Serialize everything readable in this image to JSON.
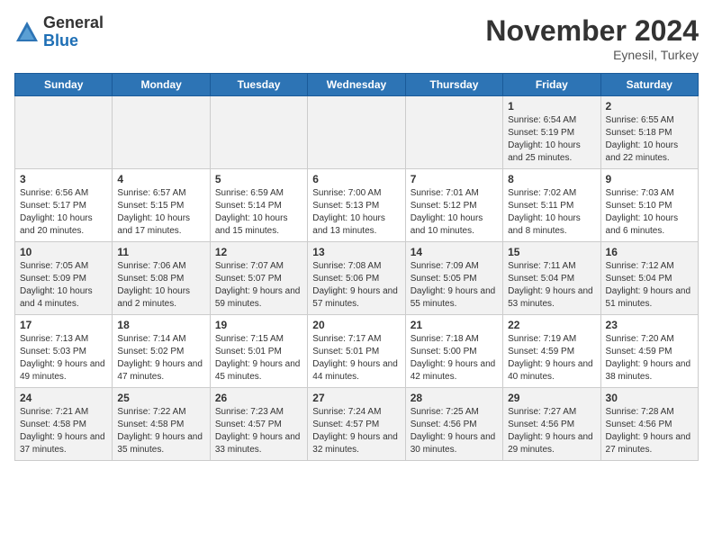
{
  "logo": {
    "general": "General",
    "blue": "Blue"
  },
  "header": {
    "month": "November 2024",
    "location": "Eynesil, Turkey"
  },
  "days_of_week": [
    "Sunday",
    "Monday",
    "Tuesday",
    "Wednesday",
    "Thursday",
    "Friday",
    "Saturday"
  ],
  "weeks": [
    [
      {
        "day": "",
        "info": ""
      },
      {
        "day": "",
        "info": ""
      },
      {
        "day": "",
        "info": ""
      },
      {
        "day": "",
        "info": ""
      },
      {
        "day": "",
        "info": ""
      },
      {
        "day": "1",
        "info": "Sunrise: 6:54 AM\nSunset: 5:19 PM\nDaylight: 10 hours and 25 minutes."
      },
      {
        "day": "2",
        "info": "Sunrise: 6:55 AM\nSunset: 5:18 PM\nDaylight: 10 hours and 22 minutes."
      }
    ],
    [
      {
        "day": "3",
        "info": "Sunrise: 6:56 AM\nSunset: 5:17 PM\nDaylight: 10 hours and 20 minutes."
      },
      {
        "day": "4",
        "info": "Sunrise: 6:57 AM\nSunset: 5:15 PM\nDaylight: 10 hours and 17 minutes."
      },
      {
        "day": "5",
        "info": "Sunrise: 6:59 AM\nSunset: 5:14 PM\nDaylight: 10 hours and 15 minutes."
      },
      {
        "day": "6",
        "info": "Sunrise: 7:00 AM\nSunset: 5:13 PM\nDaylight: 10 hours and 13 minutes."
      },
      {
        "day": "7",
        "info": "Sunrise: 7:01 AM\nSunset: 5:12 PM\nDaylight: 10 hours and 10 minutes."
      },
      {
        "day": "8",
        "info": "Sunrise: 7:02 AM\nSunset: 5:11 PM\nDaylight: 10 hours and 8 minutes."
      },
      {
        "day": "9",
        "info": "Sunrise: 7:03 AM\nSunset: 5:10 PM\nDaylight: 10 hours and 6 minutes."
      }
    ],
    [
      {
        "day": "10",
        "info": "Sunrise: 7:05 AM\nSunset: 5:09 PM\nDaylight: 10 hours and 4 minutes."
      },
      {
        "day": "11",
        "info": "Sunrise: 7:06 AM\nSunset: 5:08 PM\nDaylight: 10 hours and 2 minutes."
      },
      {
        "day": "12",
        "info": "Sunrise: 7:07 AM\nSunset: 5:07 PM\nDaylight: 9 hours and 59 minutes."
      },
      {
        "day": "13",
        "info": "Sunrise: 7:08 AM\nSunset: 5:06 PM\nDaylight: 9 hours and 57 minutes."
      },
      {
        "day": "14",
        "info": "Sunrise: 7:09 AM\nSunset: 5:05 PM\nDaylight: 9 hours and 55 minutes."
      },
      {
        "day": "15",
        "info": "Sunrise: 7:11 AM\nSunset: 5:04 PM\nDaylight: 9 hours and 53 minutes."
      },
      {
        "day": "16",
        "info": "Sunrise: 7:12 AM\nSunset: 5:04 PM\nDaylight: 9 hours and 51 minutes."
      }
    ],
    [
      {
        "day": "17",
        "info": "Sunrise: 7:13 AM\nSunset: 5:03 PM\nDaylight: 9 hours and 49 minutes."
      },
      {
        "day": "18",
        "info": "Sunrise: 7:14 AM\nSunset: 5:02 PM\nDaylight: 9 hours and 47 minutes."
      },
      {
        "day": "19",
        "info": "Sunrise: 7:15 AM\nSunset: 5:01 PM\nDaylight: 9 hours and 45 minutes."
      },
      {
        "day": "20",
        "info": "Sunrise: 7:17 AM\nSunset: 5:01 PM\nDaylight: 9 hours and 44 minutes."
      },
      {
        "day": "21",
        "info": "Sunrise: 7:18 AM\nSunset: 5:00 PM\nDaylight: 9 hours and 42 minutes."
      },
      {
        "day": "22",
        "info": "Sunrise: 7:19 AM\nSunset: 4:59 PM\nDaylight: 9 hours and 40 minutes."
      },
      {
        "day": "23",
        "info": "Sunrise: 7:20 AM\nSunset: 4:59 PM\nDaylight: 9 hours and 38 minutes."
      }
    ],
    [
      {
        "day": "24",
        "info": "Sunrise: 7:21 AM\nSunset: 4:58 PM\nDaylight: 9 hours and 37 minutes."
      },
      {
        "day": "25",
        "info": "Sunrise: 7:22 AM\nSunset: 4:58 PM\nDaylight: 9 hours and 35 minutes."
      },
      {
        "day": "26",
        "info": "Sunrise: 7:23 AM\nSunset: 4:57 PM\nDaylight: 9 hours and 33 minutes."
      },
      {
        "day": "27",
        "info": "Sunrise: 7:24 AM\nSunset: 4:57 PM\nDaylight: 9 hours and 32 minutes."
      },
      {
        "day": "28",
        "info": "Sunrise: 7:25 AM\nSunset: 4:56 PM\nDaylight: 9 hours and 30 minutes."
      },
      {
        "day": "29",
        "info": "Sunrise: 7:27 AM\nSunset: 4:56 PM\nDaylight: 9 hours and 29 minutes."
      },
      {
        "day": "30",
        "info": "Sunrise: 7:28 AM\nSunset: 4:56 PM\nDaylight: 9 hours and 27 minutes."
      }
    ]
  ]
}
